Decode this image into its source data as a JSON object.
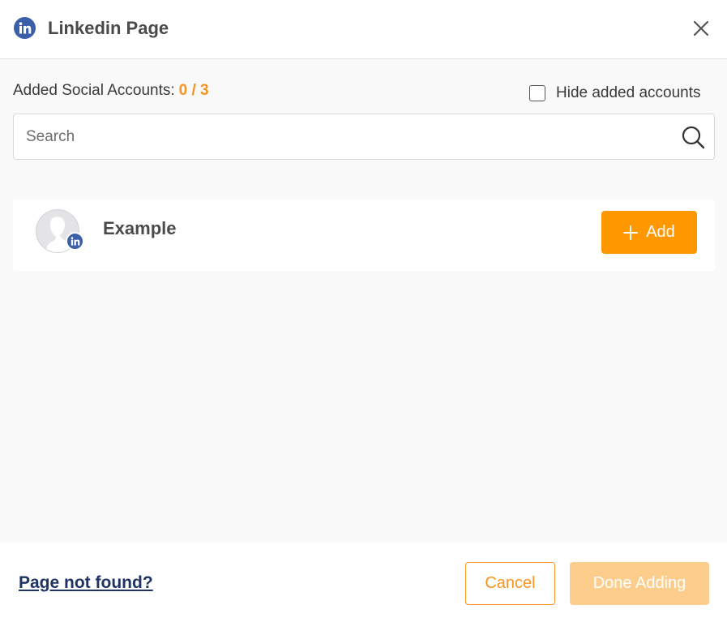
{
  "header": {
    "title": "Linkedin Page",
    "brand_icon": "linkedin-icon",
    "close_icon": "close-icon",
    "brand_color": "#3b5fa8"
  },
  "counter": {
    "label": "Added Social Accounts:",
    "value": "0 / 3",
    "accent_color": "#f7931e"
  },
  "hide_toggle": {
    "label": "Hide added accounts",
    "checked": false
  },
  "search": {
    "placeholder": "Search",
    "value": "",
    "icon": "search-icon"
  },
  "accounts": [
    {
      "name": "Example",
      "avatar_icon": "default-avatar-icon",
      "network_badge": "linkedin-icon",
      "add_label": "Add",
      "add_color": "#ff9800"
    }
  ],
  "footer": {
    "not_found_link": "Page not found?",
    "cancel_label": "Cancel",
    "done_label": "Done Adding",
    "done_disabled": true
  }
}
